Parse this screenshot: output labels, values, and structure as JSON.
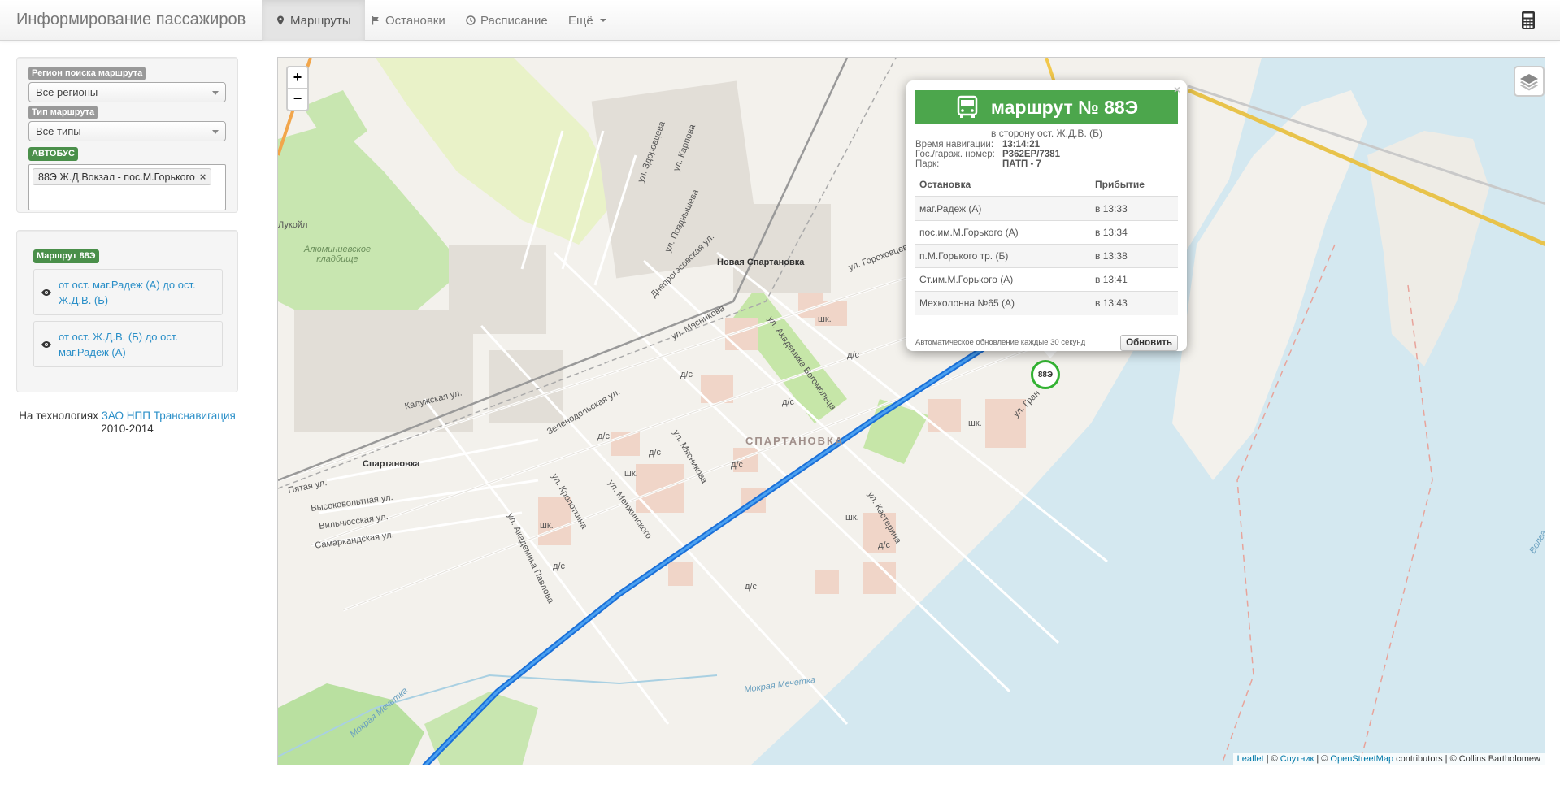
{
  "navbar": {
    "brand": "Информирование пассажиров",
    "items": [
      {
        "label": "Маршруты",
        "icon": "map-marker-icon",
        "active": true
      },
      {
        "label": "Остановки",
        "icon": "flag-icon",
        "active": false
      },
      {
        "label": "Расписание",
        "icon": "clock-icon",
        "active": false
      },
      {
        "label": "Ещё",
        "icon": "caret-down-icon",
        "active": false
      }
    ],
    "right_icon": "calculator-icon"
  },
  "search": {
    "region_label": "Регион поиска маршрута",
    "region_value": "Все регионы",
    "type_label": "Тип маршрута",
    "type_value": "Все типы",
    "bus_label": "АВТОБУС",
    "selected_route": "88Э Ж.Д.Вокзал - пос.М.Горького",
    "remove_symbol": "×"
  },
  "route_panel": {
    "badge": "Маршрут 88Э",
    "directions": [
      "от ост. маг.Радеж (А) до ост. Ж.Д.В. (Б)",
      "от ост. Ж.Д.В. (Б) до ост. маг.Радеж (А)"
    ]
  },
  "footer": {
    "prefix": "На технологиях",
    "company": "ЗАО НПП Транснавигация",
    "years": "2010-2014"
  },
  "map": {
    "zoom_in": "+",
    "zoom_out": "−",
    "attribution": {
      "leaflet": "Leaflet",
      "sep1": " | © ",
      "sputnik": "Спутник",
      "sep2": " | © ",
      "osm": "OpenStreetMap",
      "rest": " contributors | © Collins Bartholomew"
    },
    "labels": {
      "novaya_spartanovka": "Новая Спартановка",
      "spartanovka_station": "Спартановка",
      "district": "СПАРТАНОВКА",
      "kaluzhskaya": "Калужская ул.",
      "zelenodolskaya": "Зеленодольская ул.",
      "myasnikova": "ул. Мясникова",
      "myasnikova2": "ул. Мясникова",
      "bogomoltsa": "ул. Академика Богомольца",
      "kropotkina": "ул. Кропоткина",
      "menzhinskogo": "ул. Менжинского",
      "pavlova": "ул. Академика Павлова",
      "kasterina": "ул. Кастерина",
      "pyataya": "Пятая ул.",
      "vysokovoltnaya": "Высоковольтная ул.",
      "vilnyusskaya": "Вильнюсская ул.",
      "samarkandskaya": "Самаркандская ул.",
      "zdorovtsy": "ул. Здоровцева",
      "karpova": "ул. Карпова",
      "pozdnysheva": "ул. Позднышева",
      "dneprogesovskaya": "Днепрогэсовская ул.",
      "gorokhovtsev": "ул. Гороховцев",
      "gran": "ул. Гран",
      "cemetery": "Алюминиевское кладбище",
      "lukoil": "Лукойл",
      "mokraya_mechetka": "Мокрая Мечетка",
      "mokraya_mechetka2": "Мокрая Мечетка",
      "volga": "Волга",
      "school1": "шк.",
      "school2": "шк.",
      "school3": "шк.",
      "school4": "шк.",
      "school5": "шк.",
      "kg1": "д/с",
      "kg2": "д/с",
      "kg3": "д/с",
      "kg4": "д/с",
      "kg5": "д/с",
      "kg6": "д/с",
      "kg7": "д/с",
      "kg8": "д/с",
      "kg9": "д/с"
    },
    "bus_marker": "88Э",
    "route_color": "#2a8fe8"
  },
  "popup": {
    "close": "×",
    "title": "маршрут № 88Э",
    "direction": "в сторону ост. Ж.Д.В. (Б)",
    "info": [
      {
        "k": "Время навигации:",
        "v": "13:14:21"
      },
      {
        "k": "Гос./гараж. номер:",
        "v": "Р362ЕР/7381"
      },
      {
        "k": "Парк:",
        "v": "ПАТП - 7"
      }
    ],
    "columns": [
      "Остановка",
      "Прибытие"
    ],
    "stops": [
      {
        "name": "маг.Радеж (А)",
        "time": "в 13:33"
      },
      {
        "name": "пос.им.М.Горького (А)",
        "time": "в 13:34"
      },
      {
        "name": "п.М.Горького тр. (Б)",
        "time": "в 13:38"
      },
      {
        "name": "Ст.им.М.Горького (А)",
        "time": "в 13:41"
      },
      {
        "name": "Мехколонна №65 (А)",
        "time": "в 13:43"
      }
    ],
    "auto_note": "Автоматическое обновление каждые 30 секунд",
    "refresh": "Обновить",
    "header_color": "#4ca64c"
  }
}
